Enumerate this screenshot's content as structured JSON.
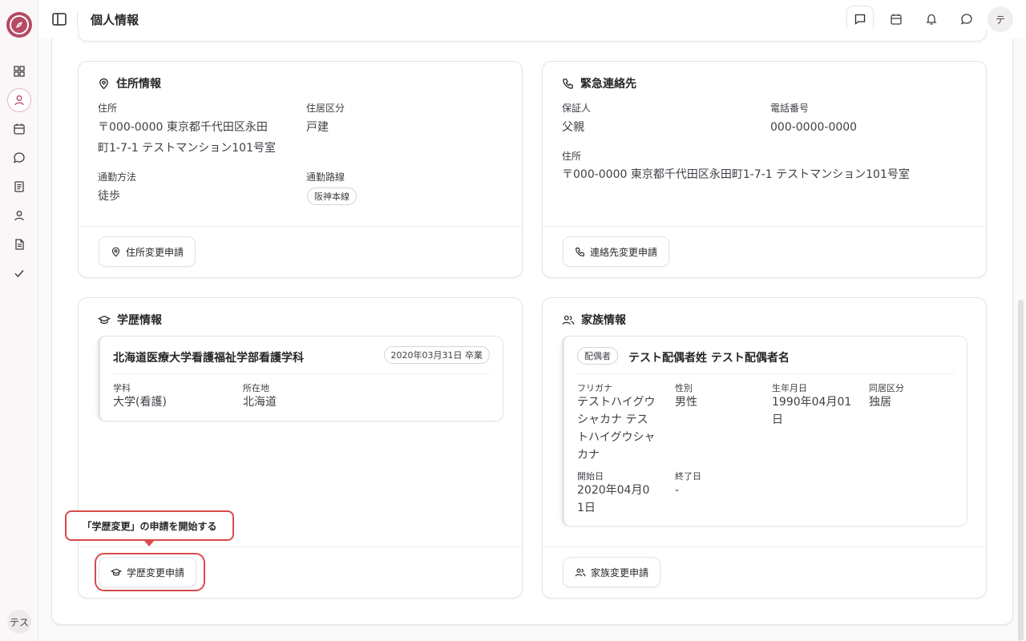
{
  "header": {
    "title": "個人情報",
    "avatar": "テ"
  },
  "sidebar": {
    "user_badge": "テス"
  },
  "address_card": {
    "title": "住所情報",
    "address_label": "住所",
    "address_line1": "〒000-0000 東京都千代田区永田",
    "address_line2": "町1-7-1 テストマンション101号室",
    "housing_label": "住居区分",
    "housing_value": "戸建",
    "commute_label": "通勤方法",
    "commute_value": "徒歩",
    "route_label": "通勤路線",
    "route_value": "阪神本線",
    "button": "住所変更申請"
  },
  "emergency_card": {
    "title": "緊急連絡先",
    "guarantor_label": "保証人",
    "guarantor_value": "父親",
    "phone_label": "電話番号",
    "phone_value": "000-0000-0000",
    "address_label": "住所",
    "address_value": "〒000-0000 東京都千代田区永田町1-7-1 テストマンション101号室",
    "button": "連絡先変更申請"
  },
  "education_card": {
    "title": "学歴情報",
    "school": "北海道医療大学看護福祉学部看護学科",
    "graduation": "2020年03月31日 卒業",
    "department_label": "学科",
    "department_value": "大学(看護)",
    "location_label": "所在地",
    "location_value": "北海道",
    "button": "学歴変更申請",
    "tooltip": "「学歴変更」の申請を開始する"
  },
  "family_card": {
    "title": "家族情報",
    "relation_badge": "配偶者",
    "name": "テスト配偶者姓 テスト配偶者名",
    "furigana_label": "フリガナ",
    "furigana_lines": [
      "テストハイグウ",
      "シャカナ テス",
      "トハイグウシャ",
      "カナ"
    ],
    "gender_label": "性別",
    "gender_value": "男性",
    "birth_label": "生年月日",
    "birth_lines": [
      "1990年04月01",
      "日"
    ],
    "cohabit_label": "同居区分",
    "cohabit_value": "独居",
    "start_label": "開始日",
    "start_lines": [
      "2020年04月0",
      "1日"
    ],
    "end_label": "終了日",
    "end_value": "-",
    "button": "家族変更申請"
  },
  "colors": {
    "brand": "#b64b66",
    "highlight": "#d94a4a"
  }
}
